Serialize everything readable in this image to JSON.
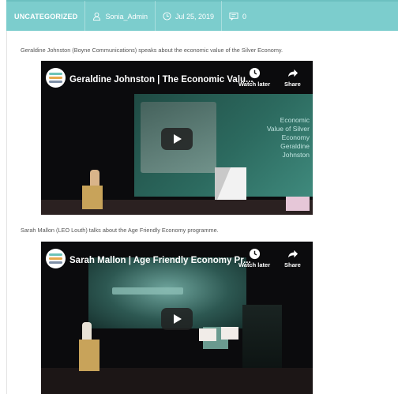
{
  "meta": {
    "category": "UNCATEGORIZED",
    "author": "Sonia_Admin",
    "date": "Jul 25, 2019",
    "comments": "0"
  },
  "posts": [
    {
      "caption": "Geraldine Johnston (Boyne Communications) speaks about the economic value of the Silver Economy.",
      "video_title": "Geraldine Johnston | The Economic Valu...",
      "watch_later": "Watch later",
      "share": "Share",
      "slide_text": [
        "Economic",
        "Value of Silver",
        "Economy",
        "",
        "Geraldine",
        "Johnston"
      ]
    },
    {
      "caption": "Sarah Mallon (LEO Louth) talks about the Age Friendly Economy programme.",
      "video_title": "Sarah Mallon | Age Friendly Economy Pr...",
      "watch_later": "Watch later",
      "share": "Share"
    }
  ],
  "icons": {
    "author": "user-icon",
    "date": "clock-icon",
    "comments": "comment-icon",
    "watch_later": "clock-icon",
    "share": "share-arrow-icon",
    "play": "play-icon"
  },
  "colors": {
    "meta_bar": "#7ccdcd",
    "video_bg": "#0b0b0d"
  }
}
